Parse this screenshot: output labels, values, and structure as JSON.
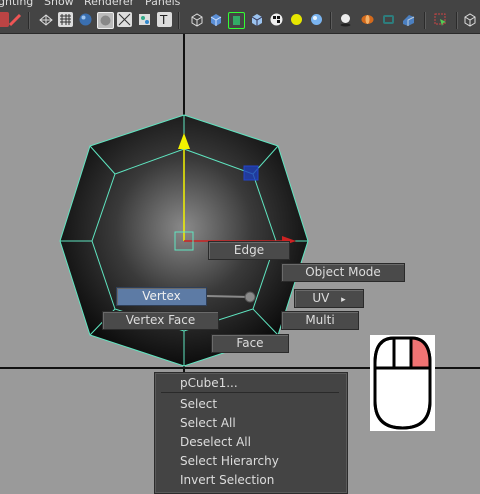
{
  "menubar": {
    "items": [
      "ghting",
      "Show",
      "Renderer",
      "Panels"
    ]
  },
  "toolbar": {
    "icons": [
      "camera-icon",
      "grid-icon",
      "sphere-icon",
      "wireframe-icon",
      "texture-icon",
      "smooth-shade-icon",
      "text-icon",
      "cube-wire-icon",
      "cube-shaded-icon",
      "isolate-select-icon",
      "cube-textured-icon",
      "checker-icon",
      "light-yellow-icon",
      "light-blue-icon",
      "shadow-icon",
      "hud-icon",
      "lasso-icon",
      "xray-icon",
      "cube-icon"
    ]
  },
  "marking_menu": {
    "edge": "Edge",
    "object_mode": "Object Mode",
    "vertex": "Vertex",
    "uv": "UV",
    "uv_arrow": "▸",
    "vertex_face": "Vertex Face",
    "multi": "Multi",
    "face": "Face"
  },
  "context_menu": {
    "title": "pCube1...",
    "items": [
      "Select",
      "Select All",
      "Deselect All",
      "Select Hierarchy",
      "Invert Selection"
    ]
  },
  "colors": {
    "ui_bg": "#444444",
    "viewport_bg": "#9a9a9a",
    "highlight": "#5d7ba5",
    "wireframe": "#5fe5c0",
    "axis_y": "#f2f200",
    "mouse_button_pressed": "#f07373"
  }
}
